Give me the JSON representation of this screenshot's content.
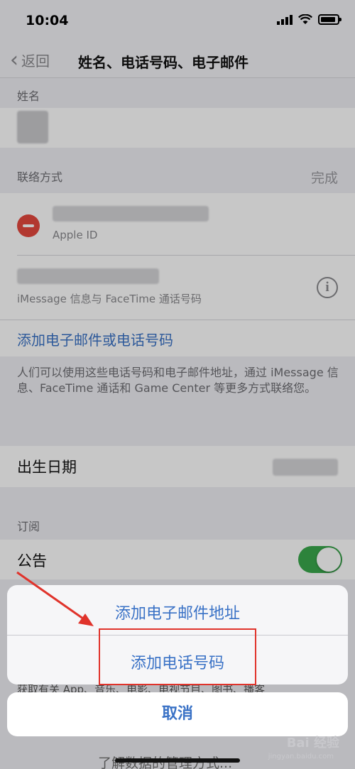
{
  "status": {
    "time": "10:04"
  },
  "nav": {
    "back_label": "返回",
    "title": "姓名、电话号码、电子邮件"
  },
  "name_section": {
    "header": "姓名"
  },
  "contact_section": {
    "header": "联络方式",
    "done_label": "完成",
    "apple_id_caption": "Apple ID",
    "phone_caption": "iMessage 信息与 FaceTime 通话号码",
    "add_link": "添加电子邮件或电话号码",
    "footer": "人们可以使用这些电话号码和电子邮件地址，通过 iMessage 信息、FaceTime 通话和 Game Center 等更多方式联络您。"
  },
  "birthday": {
    "label": "出生日期"
  },
  "subscriptions": {
    "header": "订阅",
    "announcements_label": "公告",
    "announcements_on": true,
    "peek_text": "获取有关 App、音乐、电影、电视节目、图书、播客"
  },
  "action_sheet": {
    "add_email_label": "添加电子邮件地址",
    "add_phone_label": "添加电话号码",
    "cancel_label": "取消"
  },
  "bottom": {
    "peek_text": "了解数据的管理方式..."
  },
  "watermark": {
    "brand": "Bai 经验",
    "url": "jingyan.baidu.com"
  },
  "colors": {
    "link_blue": "#3a72c6",
    "toggle_green": "#3aa84c",
    "delete_red": "#e5483e",
    "highlight_red": "#e0332b"
  }
}
